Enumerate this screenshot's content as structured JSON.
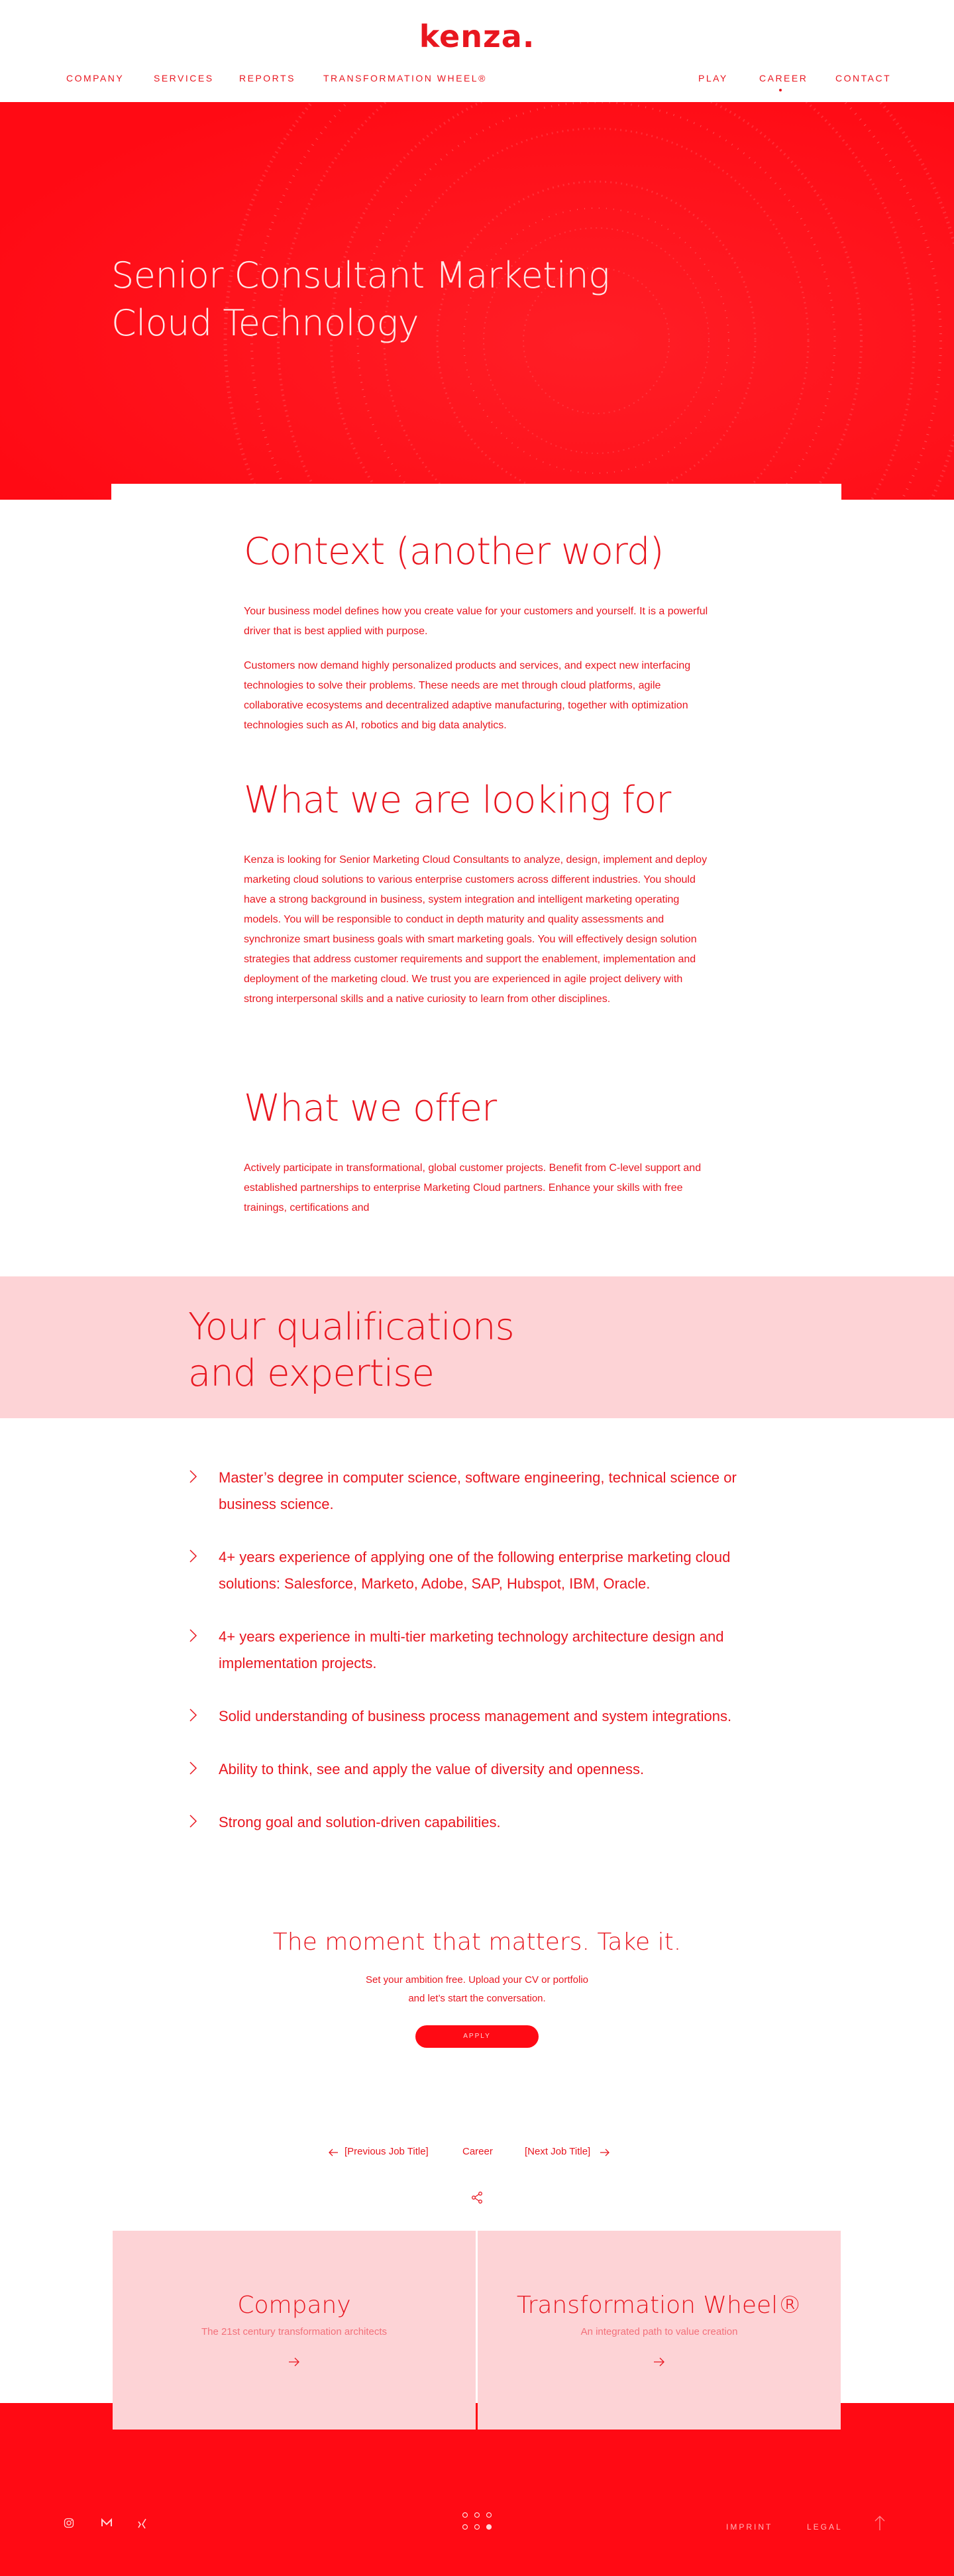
{
  "header": {
    "logo": "kenza.",
    "nav_left": [
      "COMPANY",
      "SERVICES",
      "REPORTS",
      "TRANSFORMATION WHEEL®"
    ],
    "nav_right": [
      "PLAY",
      "CAREER",
      "CONTACT"
    ],
    "active": "CAREER"
  },
  "hero": {
    "title": "Senior Consultant Marketing Cloud Technology"
  },
  "context": {
    "heading": "Context (another word)",
    "p1": "Your business model defines how you create value for your customers and yourself. It is a powerful driver that is best applied with purpose.",
    "p2": "Customers now demand highly personalized products and services, and expect new interfacing technologies to solve their problems. These needs are met through cloud platforms, agile collaborative ecosystems and decentralized adaptive manufacturing, together with optimization technologies such as AI, robotics and big data analytics."
  },
  "looking": {
    "heading": "What we are looking for",
    "p1": "Kenza is looking for Senior Marketing Cloud Consultants to analyze, design, implement and deploy marketing cloud solutions to various enterprise customers across different industries. You should have a strong background in business, system integration and intelligent marketing operating models. You will be responsible to conduct in depth maturity and quality assessments and synchronize smart business goals with smart marketing goals. You will effectively design solution strategies that address customer requirements and support the enablement, implementation and deployment of the marketing cloud. We trust you are experienced in agile project delivery with strong interpersonal skills and a native curiosity to learn from other disciplines."
  },
  "offer": {
    "heading": "What we offer",
    "p1": "Actively participate in transformational, global customer projects.  Benefit from C-level support and established partnerships to enterprise Marketing Cloud partners. Enhance your skills with free trainings, certifications and"
  },
  "qualifications": {
    "heading_line1": "Your qualifications",
    "heading_line2": "and expertise",
    "items": [
      "Master’s degree in computer science, software engineering, technical science or business science.",
      "4+ years experience of applying one of the following enterprise marketing cloud solutions: Salesforce, Marketo, Adobe, SAP, Hubspot, IBM, Oracle.",
      "4+ years experience in multi-tier marketing technology architecture design and implementation projects.",
      "Solid understanding of business process management and system integrations.",
      "Ability to think, see and apply the value of diversity and openness.",
      "Strong goal and solution-driven capabilities."
    ]
  },
  "cta": {
    "title": "The moment that matters. Take it.",
    "sub1": "Set your ambition free. Upload your CV or portfolio",
    "sub2": "and let’s start the conversation.",
    "button": "APPLY"
  },
  "jobnav": {
    "prev": "[Previous Job Title]",
    "middle": "Career",
    "next": "[Next Job Title]"
  },
  "teasers": [
    {
      "title": "Company",
      "subtitle": "The 21st century transformation architects"
    },
    {
      "title": "Transformation Wheel®",
      "subtitle": "An integrated path to value creation"
    }
  ],
  "footer": {
    "icons": [
      "instagram-icon",
      "medium-icon",
      "xing-icon"
    ],
    "links": [
      "IMPRINT",
      "LEGAL"
    ]
  },
  "colors": {
    "brand_red": "#e8161f",
    "hero_red": "#ff0a14",
    "pink": "#fdd3d6"
  }
}
